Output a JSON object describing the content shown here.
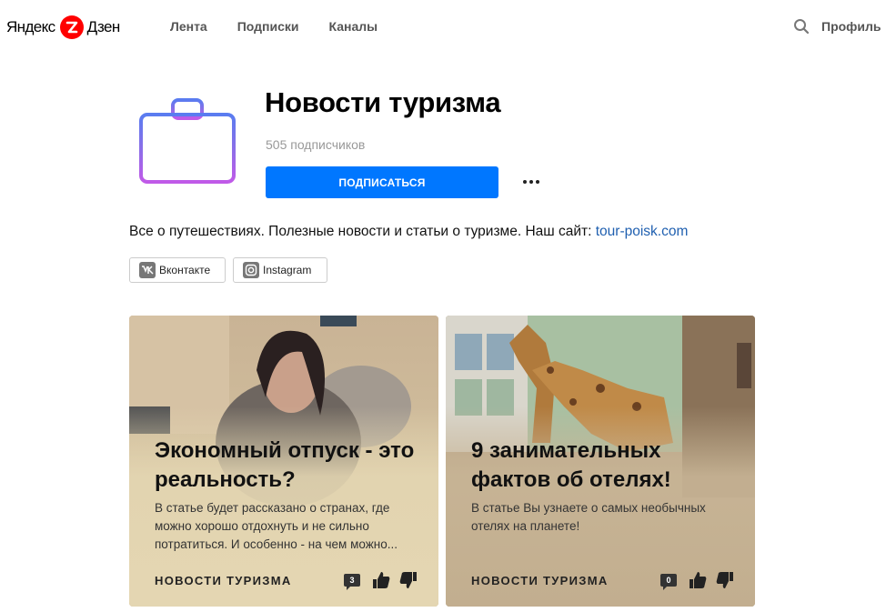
{
  "header": {
    "logo_left": "Яндекс",
    "logo_right": "Дзен",
    "nav": [
      "Лента",
      "Подписки",
      "Каналы"
    ],
    "profile_label": "Профиль",
    "search_icon": "search-icon"
  },
  "channel": {
    "title": "Новости туризма",
    "subscribers": "505 подписчиков",
    "subscribe_label": "ПОДПИСАТЬСЯ",
    "description_text": "Все о путешествиях. Полезные новости и статьи о туризме. Наш сайт: ",
    "description_link": "tour-poisk.com",
    "logo_icon": "briefcase-icon",
    "accent_color": "#0077ff"
  },
  "social": [
    {
      "label": "Вконтакте",
      "icon": "vk-icon"
    },
    {
      "label": "Instagram",
      "icon": "instagram-icon"
    }
  ],
  "cards": [
    {
      "title": "Экономный отпуск - это реальность?",
      "text": "В статье будет рассказано о странах, где можно хорошо отдохнуть и не сильно потратиться. И особенно - на чем можно...",
      "source": "НОВОСТИ ТУРИЗМА",
      "comments": "3"
    },
    {
      "title": "9 занимательных фактов об отелях!",
      "text": "В статье Вы узнаете о самых необычных отелях на планете!",
      "source": "НОВОСТИ ТУРИЗМА",
      "comments": "0"
    }
  ]
}
